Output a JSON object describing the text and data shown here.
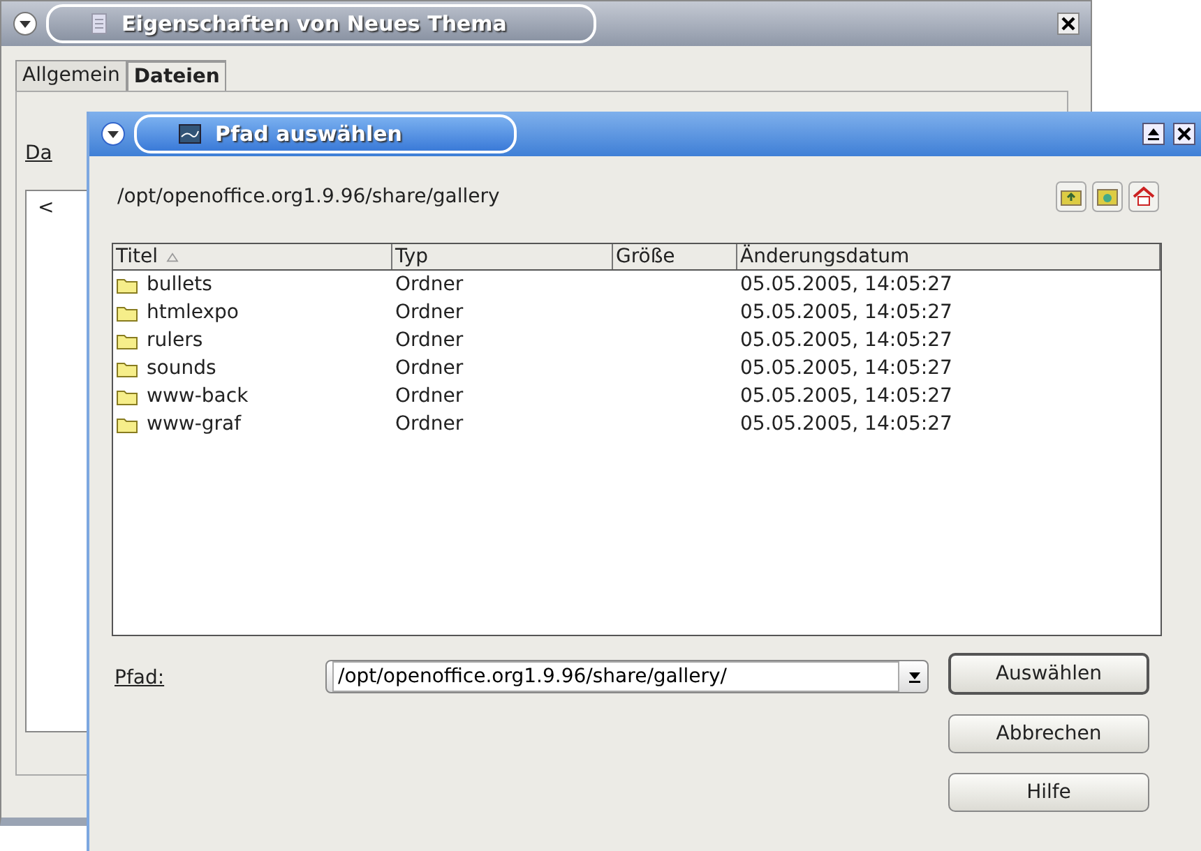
{
  "back_window": {
    "title": "Eigenschaften von Neues Thema",
    "tabs": [
      {
        "label": "Allgemein",
        "selected": false
      },
      {
        "label": "Dateien",
        "selected": true
      }
    ],
    "field_label": "Da",
    "list_text": "<"
  },
  "dialog": {
    "title": "Pfad auswählen",
    "current_path": "/opt/openoffice.org1.9.96/share/gallery",
    "table": {
      "columns": [
        {
          "label": "Titel",
          "sorted": true
        },
        {
          "label": "Typ",
          "sorted": false
        },
        {
          "label": "Größe",
          "sorted": false
        },
        {
          "label": "Änderungsdatum",
          "sorted": false
        }
      ],
      "rows": [
        {
          "name": "bullets",
          "type": "Ordner",
          "size": "",
          "date": "05.05.2005, 14:05:27"
        },
        {
          "name": "htmlexpo",
          "type": "Ordner",
          "size": "",
          "date": "05.05.2005, 14:05:27"
        },
        {
          "name": "rulers",
          "type": "Ordner",
          "size": "",
          "date": "05.05.2005, 14:05:27"
        },
        {
          "name": "sounds",
          "type": "Ordner",
          "size": "",
          "date": "05.05.2005, 14:05:27"
        },
        {
          "name": "www-back",
          "type": "Ordner",
          "size": "",
          "date": "05.05.2005, 14:05:27"
        },
        {
          "name": "www-graf",
          "type": "Ordner",
          "size": "",
          "date": "05.05.2005, 14:05:27"
        }
      ]
    },
    "path_label": "Pfad:",
    "path_value": "/opt/openoffice.org1.9.96/share/gallery/",
    "buttons": [
      {
        "label": "Auswählen",
        "default": true
      },
      {
        "label": "Abbrechen",
        "default": false
      },
      {
        "label": "Hilfe",
        "default": false
      }
    ]
  }
}
